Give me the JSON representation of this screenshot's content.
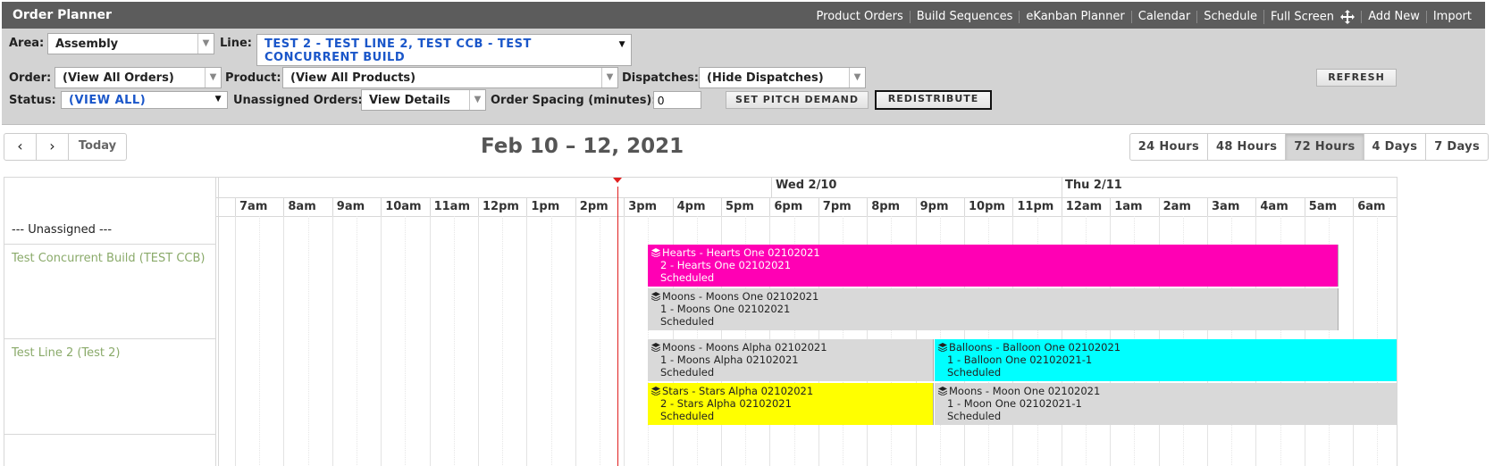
{
  "app": {
    "title": "Order Planner"
  },
  "nav": [
    {
      "label": "Product Orders"
    },
    {
      "label": "Build Sequences"
    },
    {
      "label": "eKanban Planner"
    },
    {
      "label": "Calendar"
    },
    {
      "label": "Schedule"
    },
    {
      "label": "Full Screen",
      "icon": "move-icon"
    },
    {
      "label": "Add New"
    },
    {
      "label": "Import"
    }
  ],
  "filters": {
    "area_label": "Area:",
    "area_value": "Assembly",
    "line_label": "Line:",
    "line_value": "TEST 2 - TEST LINE 2, TEST CCB - TEST CONCURRENT BUILD",
    "order_label": "Order:",
    "order_value": "(View All Orders)",
    "product_label": "Product:",
    "product_value": "(View All Products)",
    "dispatches_label": "Dispatches:",
    "dispatches_value": "(Hide Dispatches)",
    "status_label": "Status:",
    "status_value": "(VIEW ALL)",
    "unassigned_label": "Unassigned Orders:",
    "unassigned_value": "View Details",
    "spacing_label": "Order Spacing (minutes):",
    "spacing_value": "0",
    "set_pitch_label": "SET PITCH DEMAND",
    "redistribute_label": "REDISTRIBUTE",
    "refresh_label": "REFRESH"
  },
  "calendar": {
    "prev_label": "‹",
    "next_label": "›",
    "today_label": "Today",
    "range_title": "Feb 10 – 12, 2021",
    "views": [
      {
        "label": "24 Hours",
        "active": false
      },
      {
        "label": "48 Hours",
        "active": false
      },
      {
        "label": "72 Hours",
        "active": true
      },
      {
        "label": "4 Days",
        "active": false
      },
      {
        "label": "7 Days",
        "active": false
      }
    ],
    "days": [
      {
        "label": "Wed 2/10"
      },
      {
        "label": "Thu 2/11"
      }
    ],
    "hours": [
      "7am",
      "8am",
      "9am",
      "10am",
      "11am",
      "12pm",
      "1pm",
      "2pm",
      "3pm",
      "4pm",
      "5pm",
      "6pm",
      "7pm",
      "8pm",
      "9pm",
      "10pm",
      "11pm",
      "12am",
      "1am",
      "2am",
      "3am",
      "4am",
      "5am",
      "6am"
    ],
    "rows": [
      {
        "name": "--- Unassigned ---",
        "style": "plain"
      },
      {
        "name": "Test Concurrent Build (TEST CCB)",
        "style": "green"
      },
      {
        "name": "Test Line 2 (Test 2)",
        "style": "green"
      }
    ],
    "events": [
      {
        "line1": "Hearts - Hearts One 02102021",
        "line2": "2 - Hearts One 02102021",
        "line3": "Scheduled",
        "color": "#ff00b4",
        "text": "light"
      },
      {
        "line1": "Moons - Moons One 02102021",
        "line2": "1 - Moons One 02102021",
        "line3": "Scheduled",
        "color": "#d9d9d9",
        "text": "dark"
      },
      {
        "line1": "Moons - Moons Alpha 02102021",
        "line2": "1 - Moons Alpha 02102021",
        "line3": "Scheduled",
        "color": "#d9d9d9",
        "text": "dark"
      },
      {
        "line1": "Balloons - Balloon One 02102021",
        "line2": "1 - Balloon One 02102021-1",
        "line3": "Scheduled",
        "color": "#00ffff",
        "text": "dark"
      },
      {
        "line1": "Stars - Stars Alpha 02102021",
        "line2": "2 - Stars Alpha 02102021",
        "line3": "Scheduled",
        "color": "#ffff00",
        "text": "dark"
      },
      {
        "line1": "Moons - Moon One 02102021",
        "line2": "1 - Moon One 02102021-1",
        "line3": "Scheduled",
        "color": "#d9d9d9",
        "text": "dark"
      }
    ]
  },
  "colors": {
    "header_bg": "#5c5c5c",
    "filter_bg": "#d3d3d3",
    "now_line": "#e02020",
    "row_name_green": "#8aaa6a"
  }
}
